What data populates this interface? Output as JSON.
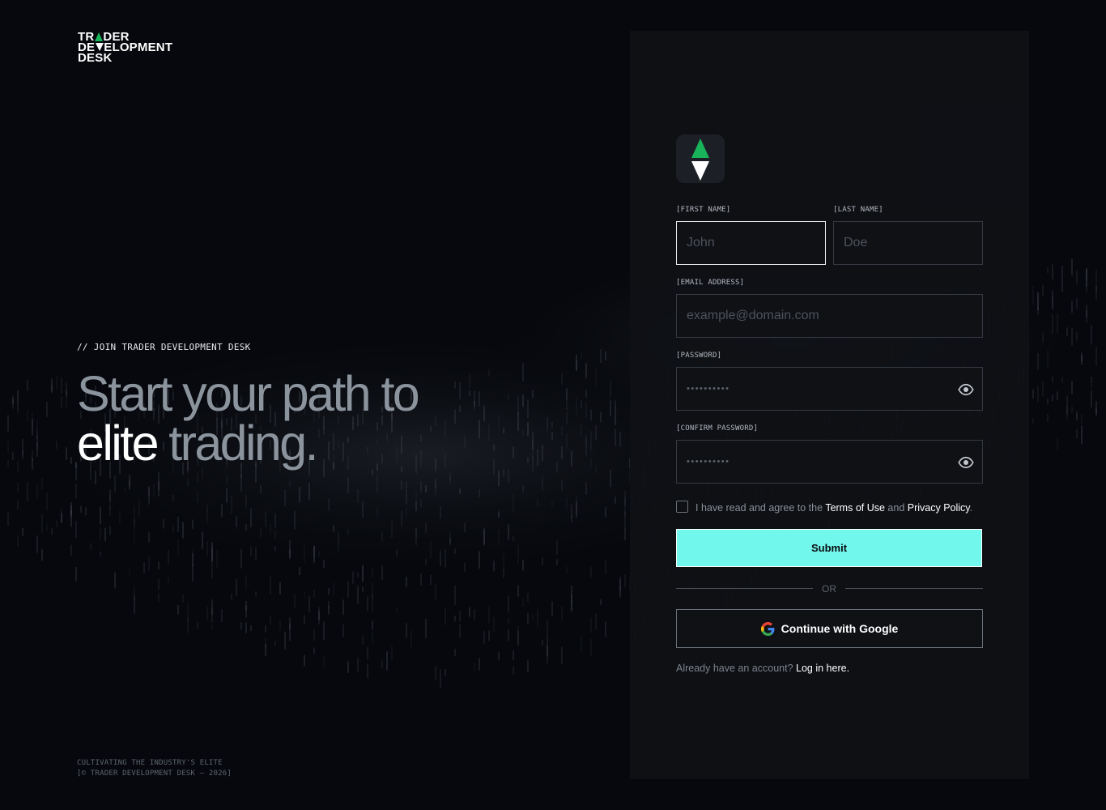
{
  "brand": {
    "logo_line1_pre": "TR",
    "logo_line1_post": "DER",
    "logo_line2_pre": "DE",
    "logo_line2_post": "ELOPMENT",
    "logo_line3": "DESK"
  },
  "hero": {
    "eyebrow": "// JOIN TRADER DEVELOPMENT DESK",
    "headline_line1": "Start your path to",
    "headline_strong": "elite",
    "headline_rest": " trading."
  },
  "footer": {
    "tagline": "CULTIVATING THE INDUSTRY'S ELITE",
    "copyright": "[© TRADER DEVELOPMENT DESK — 2026]"
  },
  "form": {
    "first_name": {
      "label": "[FIRST NAME]",
      "value": "",
      "placeholder": "John"
    },
    "last_name": {
      "label": "[LAST NAME]",
      "value": "",
      "placeholder": "Doe"
    },
    "email": {
      "label": "[EMAIL ADDRESS]",
      "value": "",
      "placeholder": "example@domain.com"
    },
    "password": {
      "label": "[PASSWORD]",
      "masked": "••••••••••",
      "icon": "eye-icon"
    },
    "confirm_password": {
      "label": "[CONFIRM PASSWORD]",
      "masked": "••••••••••",
      "icon": "eye-icon"
    },
    "agree": {
      "checked": false,
      "prefix": "I have read and agree to the ",
      "terms": "Terms of Use",
      "middle": " and ",
      "privacy": "Privacy Policy",
      "suffix": "."
    },
    "submit_label": "Submit",
    "divider_label": "OR",
    "google_label": "Continue with Google",
    "google_icon": "google-icon",
    "login_prompt": "Already have an account? ",
    "login_link": "Log in here."
  },
  "colors": {
    "background": "#06080d",
    "panel": "#0f1115",
    "accent_cyan": "#72f7ed",
    "brand_green": "#19b35a",
    "muted_text": "#8b939d"
  }
}
